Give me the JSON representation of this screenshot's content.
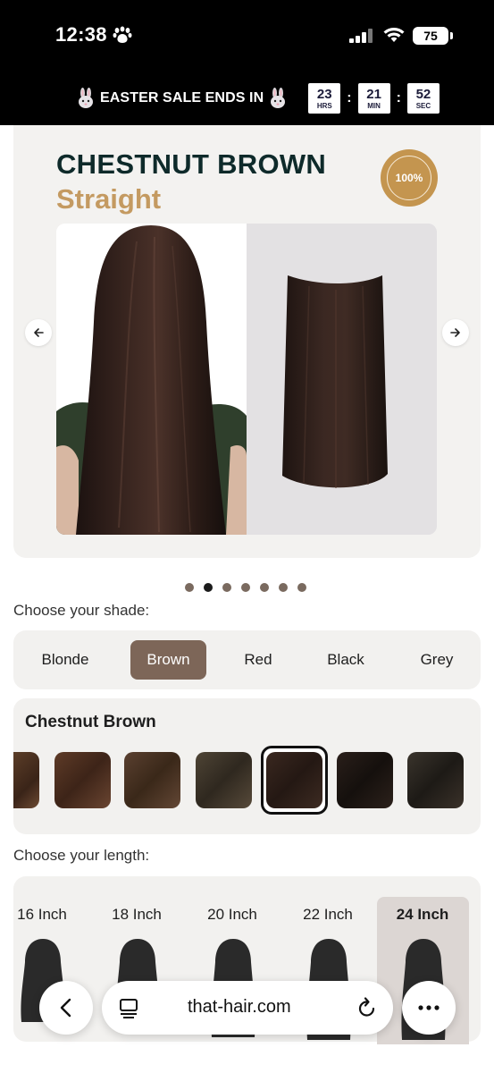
{
  "status_bar": {
    "time": "12:38",
    "battery": "75"
  },
  "sale_banner": {
    "text": "EASTER SALE ENDS IN",
    "countdown": [
      {
        "value": "23",
        "unit": "HRS"
      },
      {
        "value": "21",
        "unit": "MIN"
      },
      {
        "value": "52",
        "unit": "SEC"
      }
    ]
  },
  "product": {
    "title_color": "CHESTNUT BROWN",
    "title_style": "Straight",
    "badge": "100%",
    "carousel": {
      "slide_count": 7,
      "active_index": 1
    }
  },
  "shade": {
    "label": "Choose your shade:",
    "options": [
      "Blonde",
      "Brown",
      "Red",
      "Black",
      "Grey"
    ],
    "selected": "Brown",
    "selected_name": "Chestnut Brown",
    "swatches": [
      {
        "color": "#4a3222",
        "selected": false
      },
      {
        "color": "#4b2f1f",
        "selected": false
      },
      {
        "color": "#4a3424",
        "selected": false
      },
      {
        "color": "#3e352a",
        "selected": false
      },
      {
        "color": "#2e201a",
        "selected": true
      },
      {
        "color": "#1f1713",
        "selected": false
      },
      {
        "color": "#2c2620",
        "selected": false
      }
    ]
  },
  "length": {
    "label": "Choose your length:",
    "options": [
      "16 Inch",
      "18 Inch",
      "20 Inch",
      "22 Inch",
      "24 Inch"
    ],
    "selected": "24 Inch"
  },
  "browser": {
    "url": "that-hair.com"
  },
  "colors": {
    "accent_gold": "#c49a61",
    "title_dark": "#0e2a2a",
    "shade_selected": "#7d6658"
  }
}
